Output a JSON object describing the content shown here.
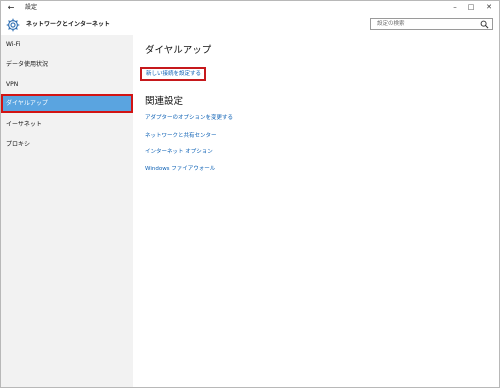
{
  "titlebar": {
    "title": "設定",
    "back_icon": "back-arrow-icon",
    "minimize_icon": "minimize-icon",
    "maximize_icon": "maximize-icon",
    "close_icon": "close-icon"
  },
  "header": {
    "icon": "gear-icon",
    "title": "ネットワークとインターネット"
  },
  "search": {
    "placeholder": "設定の検索",
    "icon": "search-icon"
  },
  "sidebar": {
    "items": [
      {
        "label": "Wi-Fi",
        "selected": false
      },
      {
        "label": "データ使用状況",
        "selected": false
      },
      {
        "label": "VPN",
        "selected": false
      },
      {
        "label": "ダイヤルアップ",
        "selected": true
      },
      {
        "label": "イーサネット",
        "selected": false
      },
      {
        "label": "プロキシ",
        "selected": false
      }
    ]
  },
  "main": {
    "title": "ダイヤルアップ",
    "new_connection_link": "新しい接続を設定する",
    "related_title": "関連設定",
    "related_links": [
      "アダプターのオプションを変更する",
      "ネットワークと共有センター",
      "インターネット オプション",
      "Windows ファイアウォール"
    ]
  },
  "colors": {
    "accent": "#5aa4e0",
    "link": "#0a5fb4",
    "highlight_border": "#d21414"
  }
}
